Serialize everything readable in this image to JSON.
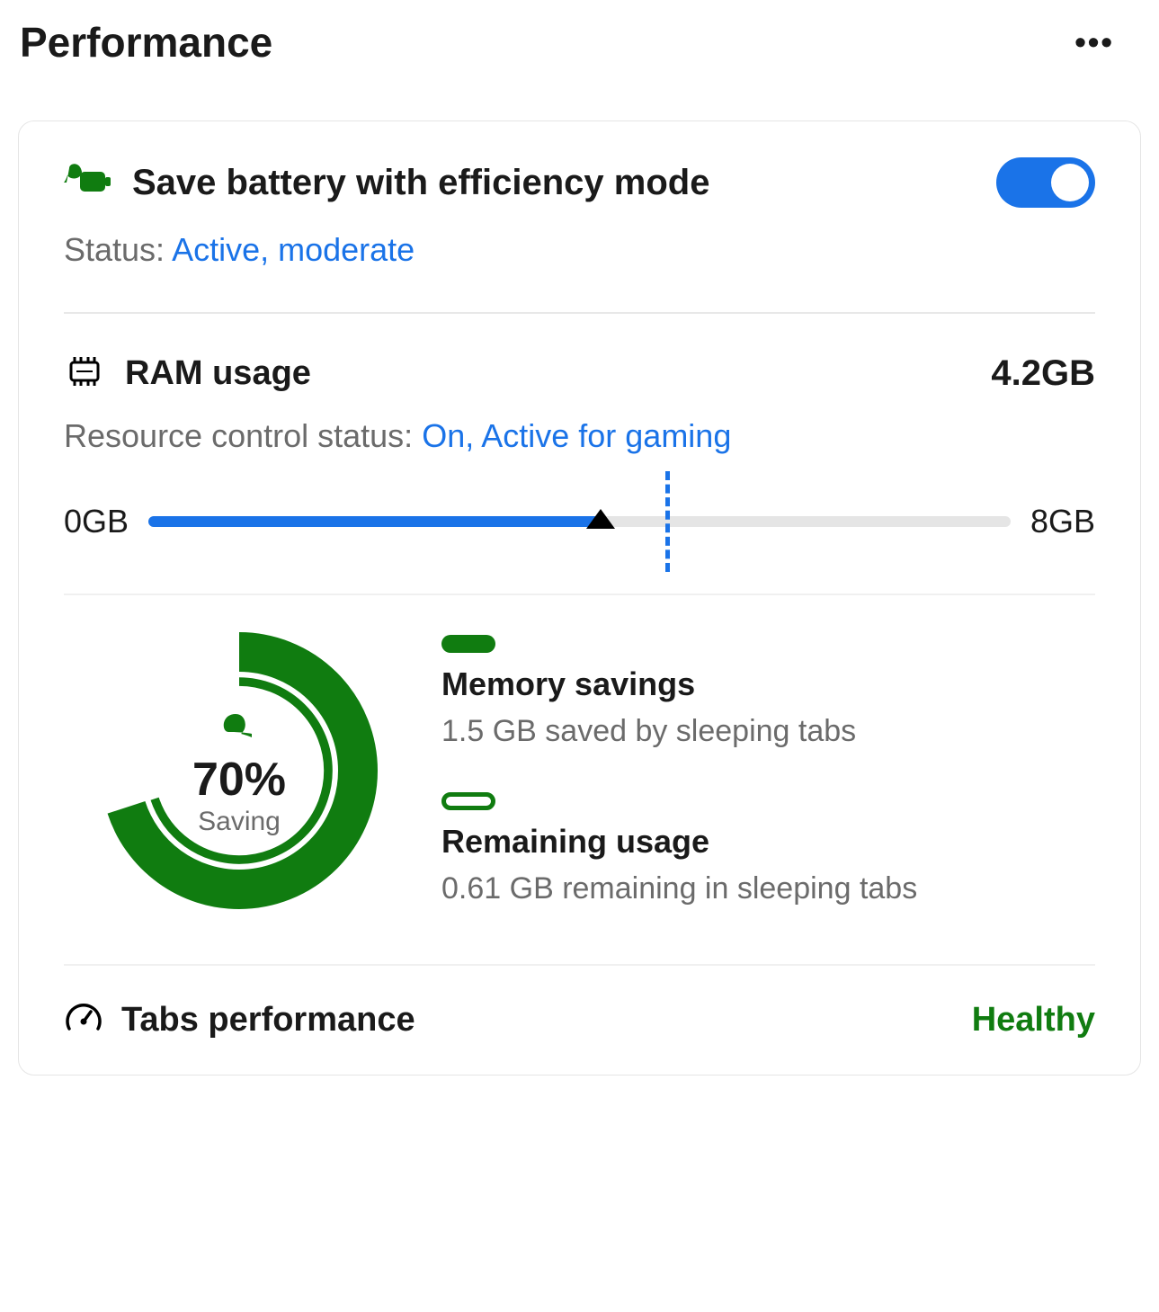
{
  "header": {
    "title": "Performance",
    "more_label": "•••"
  },
  "battery": {
    "title": "Save battery with efficiency mode",
    "status_label": "Status: ",
    "status_value": "Active, moderate",
    "toggle_on": true
  },
  "ram": {
    "title": "RAM usage",
    "value": "4.2GB",
    "resource_label": "Resource control status: ",
    "resource_value": "On, Active for gaming",
    "slider_min_label": "0GB",
    "slider_max_label": "8GB",
    "slider_min": 0,
    "slider_max": 8,
    "slider_current": 4.2,
    "slider_marker": 4.8
  },
  "savings": {
    "percent_label": "70%",
    "percent_value": 70,
    "sub_label": "Saving",
    "memory_heading": "Memory savings",
    "memory_desc": "1.5 GB saved by sleeping tabs",
    "remaining_heading": "Remaining usage",
    "remaining_desc": "0.61 GB remaining in sleeping tabs"
  },
  "tabs": {
    "title": "Tabs performance",
    "status": "Healthy"
  },
  "chart_data": {
    "type": "pie",
    "title": "Saving",
    "series": [
      {
        "name": "Memory savings",
        "value": 70
      },
      {
        "name": "Remaining usage",
        "value": 30
      }
    ]
  }
}
